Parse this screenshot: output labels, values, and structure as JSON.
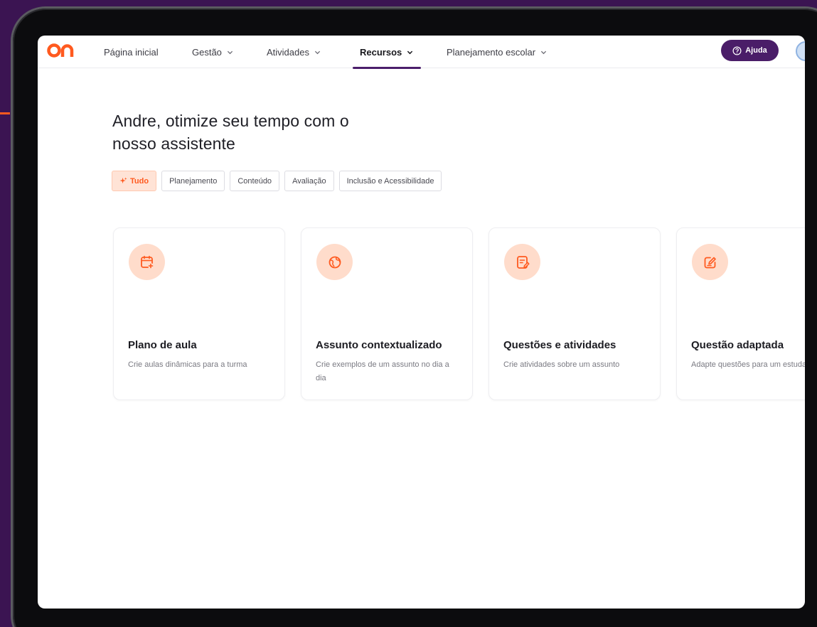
{
  "nav": {
    "items": [
      {
        "label": "Página inicial"
      },
      {
        "label": "Gestão"
      },
      {
        "label": "Atividades"
      },
      {
        "label": "Recursos"
      },
      {
        "label": "Planejamento escolar"
      }
    ],
    "help_label": "Ajuda"
  },
  "main": {
    "title_line1": "Andre, otimize seu tempo com o",
    "title_line2": "nosso assistente"
  },
  "filters": [
    {
      "label": "Tudo"
    },
    {
      "label": "Planejamento"
    },
    {
      "label": "Conteúdo"
    },
    {
      "label": "Avaliação"
    },
    {
      "label": "Inclusão e Acessibilidade"
    }
  ],
  "cards": [
    {
      "title": "Plano de aula",
      "desc": "Crie aulas dinâmicas para a turma",
      "icon": "calendar-plus-icon"
    },
    {
      "title": "Assunto contextualizado",
      "desc": "Crie exemplos de um assunto no dia a dia",
      "icon": "globe-icon"
    },
    {
      "title": "Questões e atividades",
      "desc": "Crie atividades sobre um assunto",
      "icon": "document-edit-icon"
    },
    {
      "title": "Questão adaptada",
      "desc": "Adapte questões para um estudante",
      "icon": "note-pencil-icon"
    }
  ],
  "colors": {
    "brand_orange": "#ff5a1f",
    "brand_purple": "#4a1d68",
    "icon_bg": "#ffdccb"
  }
}
